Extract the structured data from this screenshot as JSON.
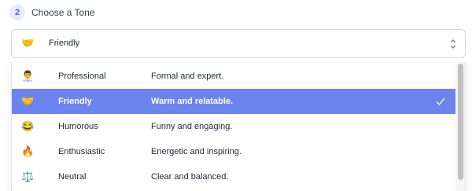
{
  "step": {
    "number": "2",
    "title": "Choose a Tone"
  },
  "select": {
    "emoji": "🤝",
    "value": "Friendly",
    "icon": "chevron-up-down-icon"
  },
  "options": [
    {
      "emoji": "👨‍💼",
      "name": "Professional",
      "description": "Formal and expert.",
      "selected": false
    },
    {
      "emoji": "🤝",
      "name": "Friendly",
      "description": "Warm and relatable.",
      "selected": true
    },
    {
      "emoji": "😂",
      "name": "Humorous",
      "description": "Funny and engaging.",
      "selected": false
    },
    {
      "emoji": "🔥",
      "name": "Enthusiastic",
      "description": "Energetic and inspiring.",
      "selected": false
    },
    {
      "emoji": "⚖️",
      "name": "Neutral",
      "description": "Clear and balanced.",
      "selected": false
    }
  ],
  "colors": {
    "accent": "#6c84ee",
    "badge_bg": "#e8ebfb",
    "badge_text": "#4f5bd5"
  }
}
